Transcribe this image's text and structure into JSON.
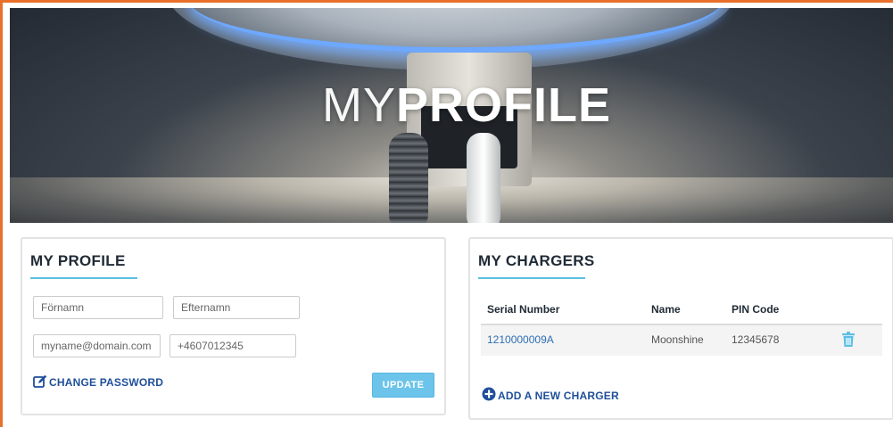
{
  "hero": {
    "title_light": "MY",
    "title_bold": "PROFILE"
  },
  "profile": {
    "title": "MY PROFILE",
    "first_name": {
      "placeholder": "Förnamn"
    },
    "last_name": {
      "placeholder": "Efternamn"
    },
    "email": {
      "placeholder": "myname@domain.com"
    },
    "phone": {
      "placeholder": "+4607012345"
    },
    "change_password_label": "CHANGE PASSWORD",
    "update_label": "UPDATE"
  },
  "chargers": {
    "title": "MY CHARGERS",
    "columns": [
      "Serial Number",
      "Name",
      "PIN Code"
    ],
    "rows": [
      {
        "serial": "1210000009A",
        "name": "Moonshine",
        "pin": "12345678"
      }
    ],
    "add_label": "ADD A NEW CHARGER"
  },
  "colors": {
    "accent_border": "#e8702a",
    "link": "#1f4f9a",
    "button": "#6cc4ea",
    "underline": "#5bc0de"
  },
  "icons": [
    "edit-icon",
    "trash-icon",
    "plus-circle-icon"
  ]
}
